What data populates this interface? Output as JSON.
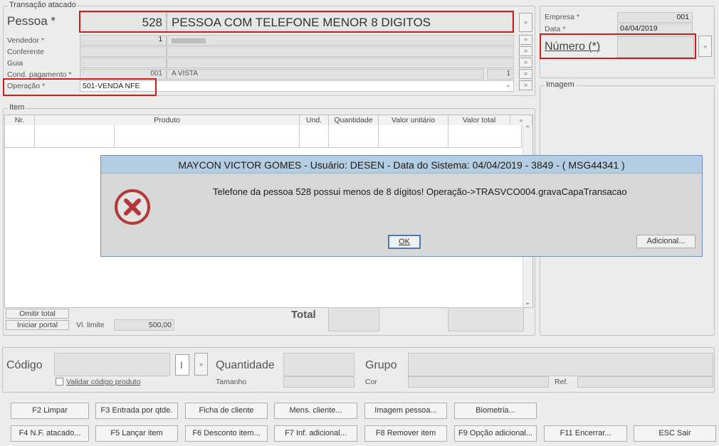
{
  "transacao": {
    "legend": "Transação atacado",
    "pessoa_label": "Pessoa *",
    "pessoa_code": "528",
    "pessoa_name": "PESSOA COM TELEFONE MENOR 8 DIGITOS",
    "vendedor_label": "Vendedor *",
    "vendedor_code": "1",
    "conferente_label": "Conferente",
    "guia_label": "Guia",
    "cond_label": "Cond. pagamento *",
    "cond_code": "001",
    "cond_name": "A VISTA",
    "cond_parcelas": "1",
    "operacao_label": "Operação *",
    "operacao_value": "501-VENDA NFE",
    "lookup_glyph": "»"
  },
  "right_panel": {
    "empresa_label": "Empresa *",
    "empresa_value": "001",
    "data_label": "Data *",
    "data_value": "04/04/2019",
    "numero_label": "Número (*)",
    "imagem_legend": "Imagem"
  },
  "item": {
    "legend": "Item",
    "columns": [
      "Nr.",
      "Produto",
      "Und.",
      "Quantidade",
      "Valor unitário",
      "Valor total"
    ],
    "omitir_total": "Omitir total",
    "iniciar_portal": "Iniciar portal",
    "vl_limite_label": "Vl. limite",
    "vl_limite_value": "500,00",
    "total_label": "Total"
  },
  "codigo": {
    "codigo_label": "Código",
    "indicator": "I",
    "quantidade_label": "Quantidade",
    "grupo_label": "Grupo",
    "validar_label": "Validar código produto",
    "tamanho_label": "Tamanho",
    "cor_label": "Cor",
    "ref_label": "Ref."
  },
  "buttons_row1": [
    "F2 Limpar",
    "F3 Entrada por qtde.",
    "Ficha de cliente",
    "Mens. cliente...",
    "Imagem pessoa...",
    "Biometria..."
  ],
  "buttons_row2": [
    "F4 N.F. atacado...",
    "F5 Lançar item",
    "F6 Desconto item...",
    "F7 Inf. adicional...",
    "F8 Remover item",
    "F9 Opção adicional...",
    "F11 Encerrar...",
    "ESC Sair"
  ],
  "dialog": {
    "title": "MAYCON VICTOR GOMES - Usuário: DESEN - Data do Sistema: 04/04/2019 - 3849 - ( MSG44341 )",
    "message": "Telefone da pessoa 528 possui menos de 8 dígitos! Operação->TRASVCO004.gravaCapaTransacao",
    "ok_label": "OK",
    "adicional_label": "Adicional...",
    "icon": "error-icon"
  },
  "colors": {
    "highlight_red": "#d11c1c",
    "dialog_title_bg": "#b5cde3",
    "error_icon": "#b43838"
  }
}
